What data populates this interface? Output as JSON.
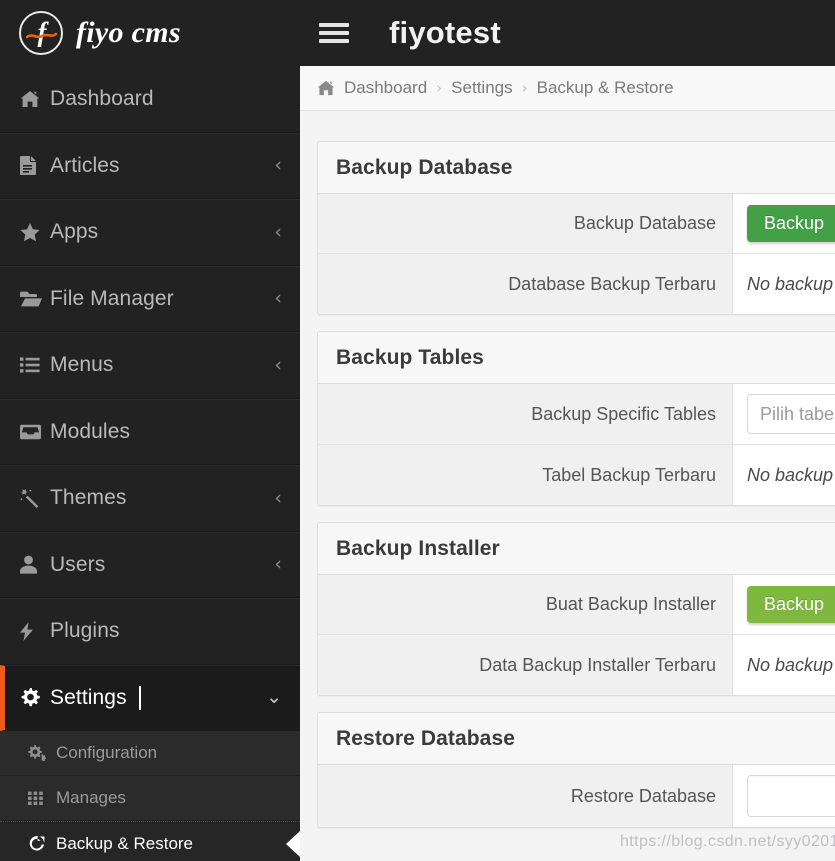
{
  "topbar": {
    "logo_mark": "fiyo-logo-icon",
    "brand": "fiyo cms",
    "menu_toggle": "hamburger-icon",
    "site_title": "fiyotest"
  },
  "sidebar": {
    "items": [
      {
        "label": "Dashboard",
        "icon": "home-icon",
        "arrow": "",
        "active": false
      },
      {
        "label": "Articles",
        "icon": "document-icon",
        "arrow": "‹",
        "active": false
      },
      {
        "label": "Apps",
        "icon": "star-icon",
        "arrow": "‹",
        "active": false
      },
      {
        "label": "File Manager",
        "icon": "folder-open-icon",
        "arrow": "‹",
        "active": false
      },
      {
        "label": "Menus",
        "icon": "list-icon",
        "arrow": "‹",
        "active": false
      },
      {
        "label": "Modules",
        "icon": "inbox-icon",
        "arrow": "",
        "active": false
      },
      {
        "label": "Themes",
        "icon": "magic-wand-icon",
        "arrow": "‹",
        "active": false
      },
      {
        "label": "Users",
        "icon": "user-icon",
        "arrow": "‹",
        "active": false
      },
      {
        "label": "Plugins",
        "icon": "bolt-icon",
        "arrow": "",
        "active": false
      },
      {
        "label": "Settings",
        "icon": "gear-icon",
        "arrow": "⌄",
        "active": true
      }
    ],
    "submenu": [
      {
        "label": "Configuration",
        "icon": "gears-icon",
        "active": false
      },
      {
        "label": "Manages",
        "icon": "grid-icon",
        "active": false
      },
      {
        "label": "Backup & Restore",
        "icon": "refresh-icon",
        "active": true
      }
    ]
  },
  "breadcrumb": {
    "home_icon": "home-icon",
    "items": [
      "Dashboard",
      "Settings",
      "Backup & Restore"
    ],
    "separator": "›"
  },
  "panels": [
    {
      "title": "Backup Database",
      "rows": [
        {
          "label": "Backup Database",
          "control": "button",
          "button_label": "Backup",
          "button_color": "#43a047"
        },
        {
          "label": "Database Backup Terbaru",
          "control": "text",
          "text": "No backup file!"
        }
      ]
    },
    {
      "title": "Backup Tables",
      "rows": [
        {
          "label": "Backup Specific Tables",
          "control": "input",
          "placeholder": "Pilih tabel",
          "value": ""
        },
        {
          "label": "Tabel Backup Terbaru",
          "control": "text",
          "text": "No backup file!"
        }
      ]
    },
    {
      "title": "Backup Installer",
      "rows": [
        {
          "label": "Buat Backup Installer",
          "control": "button",
          "button_label": "Backup",
          "button_color": "#7fb83e"
        },
        {
          "label": "Data Backup Installer Terbaru",
          "control": "text",
          "text": "No backup file!"
        }
      ]
    },
    {
      "title": "Restore Database",
      "rows": [
        {
          "label": "Restore Database",
          "control": "file",
          "value": ""
        }
      ]
    }
  ],
  "watermark": "https://blog.csdn.net/syy0201",
  "colors": {
    "accent": "#f05a1e",
    "sidebar_bg": "#222222",
    "submenu_bg": "#2b2b2b",
    "green_dark": "#43a047",
    "green_light": "#7fb83e"
  }
}
